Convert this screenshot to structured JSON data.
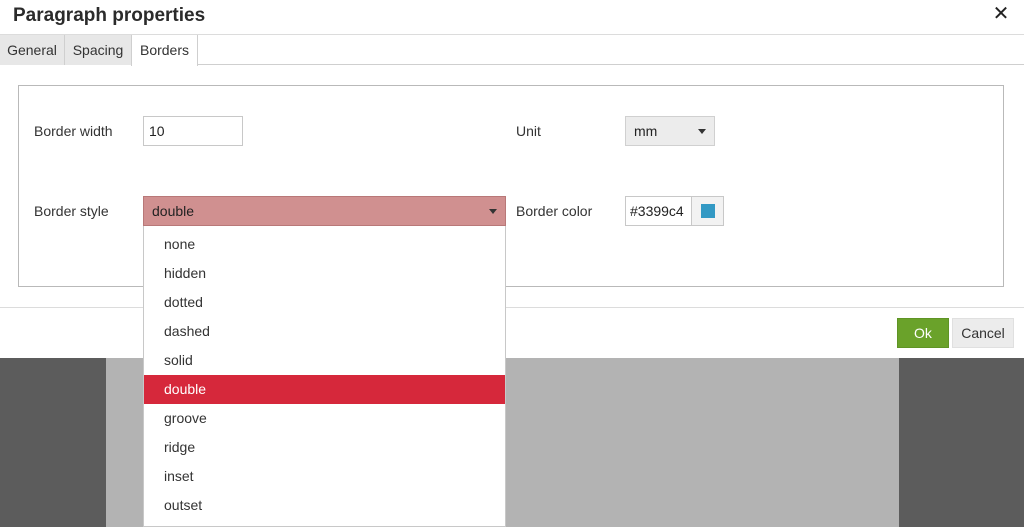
{
  "dialog": {
    "title": "Paragraph properties",
    "close_symbol": "✕"
  },
  "tabs": [
    {
      "label": "General"
    },
    {
      "label": "Spacing"
    },
    {
      "label": "Borders",
      "active": true
    }
  ],
  "form": {
    "border_width": {
      "label": "Border width",
      "value": "10"
    },
    "unit": {
      "label": "Unit",
      "value": "mm"
    },
    "border_style": {
      "label": "Border style",
      "value": "double"
    },
    "border_color": {
      "label": "Border color",
      "value": "#3399c4",
      "swatch_color": "#3399c4"
    }
  },
  "dropdown": {
    "options": [
      "none",
      "hidden",
      "dotted",
      "dashed",
      "solid",
      "double",
      "groove",
      "ridge",
      "inset",
      "outset"
    ],
    "selected": "double"
  },
  "footer": {
    "ok_label": "Ok",
    "cancel_label": "Cancel"
  },
  "colors": {
    "ok_button": "#6aa22a",
    "selected_option": "#d6283b",
    "active_select": "#d09090"
  },
  "icons": {
    "close": "close-icon",
    "caret": "chevron-down-icon"
  }
}
